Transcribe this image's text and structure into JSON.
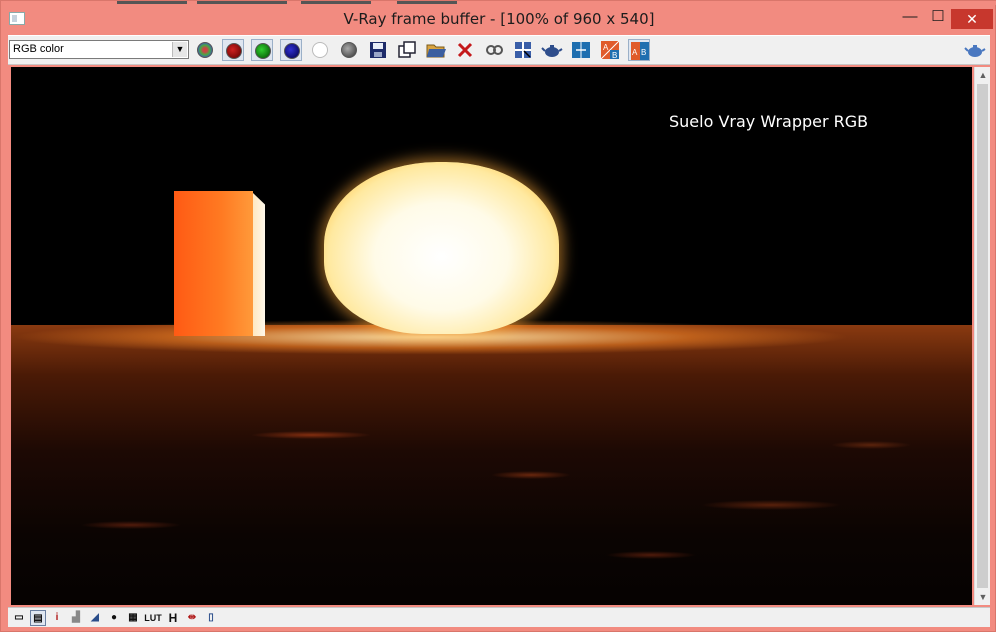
{
  "window": {
    "title": "V-Ray frame buffer - [100% of 960 x 540]",
    "minimize_glyph": "—",
    "maximize_glyph": "☐",
    "close_glyph": "✕"
  },
  "toolbar": {
    "channel_select": {
      "value": "RGB color"
    },
    "buttons": [
      {
        "name": "rgb-channels-icon",
        "color": "#6a8a6a"
      },
      {
        "name": "red-channel-icon",
        "color": "#8b0000"
      },
      {
        "name": "green-channel-icon",
        "color": "#0a7a0a"
      },
      {
        "name": "blue-channel-icon",
        "color": "#00007a"
      },
      {
        "name": "white-channel-icon",
        "color": "#ffffff"
      },
      {
        "name": "alpha-channel-icon",
        "color": "#555555"
      },
      {
        "name": "save-icon"
      },
      {
        "name": "copy-icon"
      },
      {
        "name": "open-icon"
      },
      {
        "name": "clear-icon"
      },
      {
        "name": "link-icon"
      },
      {
        "name": "track-mouse-icon"
      },
      {
        "name": "render-teapot-icon"
      },
      {
        "name": "compare-icon"
      },
      {
        "name": "ab-horizontal-icon"
      },
      {
        "name": "ab-vertical-icon"
      },
      {
        "name": "teapot-icon"
      }
    ]
  },
  "viewport": {
    "overlay_label": "Suelo Vray Wrapper RGB"
  },
  "bottombar": {
    "items": [
      {
        "name": "display-icon",
        "glyph": "▭"
      },
      {
        "name": "correction-icon",
        "glyph": "▤"
      },
      {
        "name": "info-icon",
        "glyph": "i"
      },
      {
        "name": "levels-icon",
        "glyph": "▟"
      },
      {
        "name": "curve-icon",
        "glyph": "◢"
      },
      {
        "name": "exposure-icon",
        "glyph": "●"
      },
      {
        "name": "pixel-icon",
        "glyph": "▦"
      },
      {
        "name": "lut-label",
        "glyph": "LUT"
      },
      {
        "name": "h-label",
        "glyph": "H"
      },
      {
        "name": "compare-ab-icon",
        "glyph": "⇹"
      },
      {
        "name": "rgb-split-icon",
        "glyph": "▯"
      }
    ]
  }
}
